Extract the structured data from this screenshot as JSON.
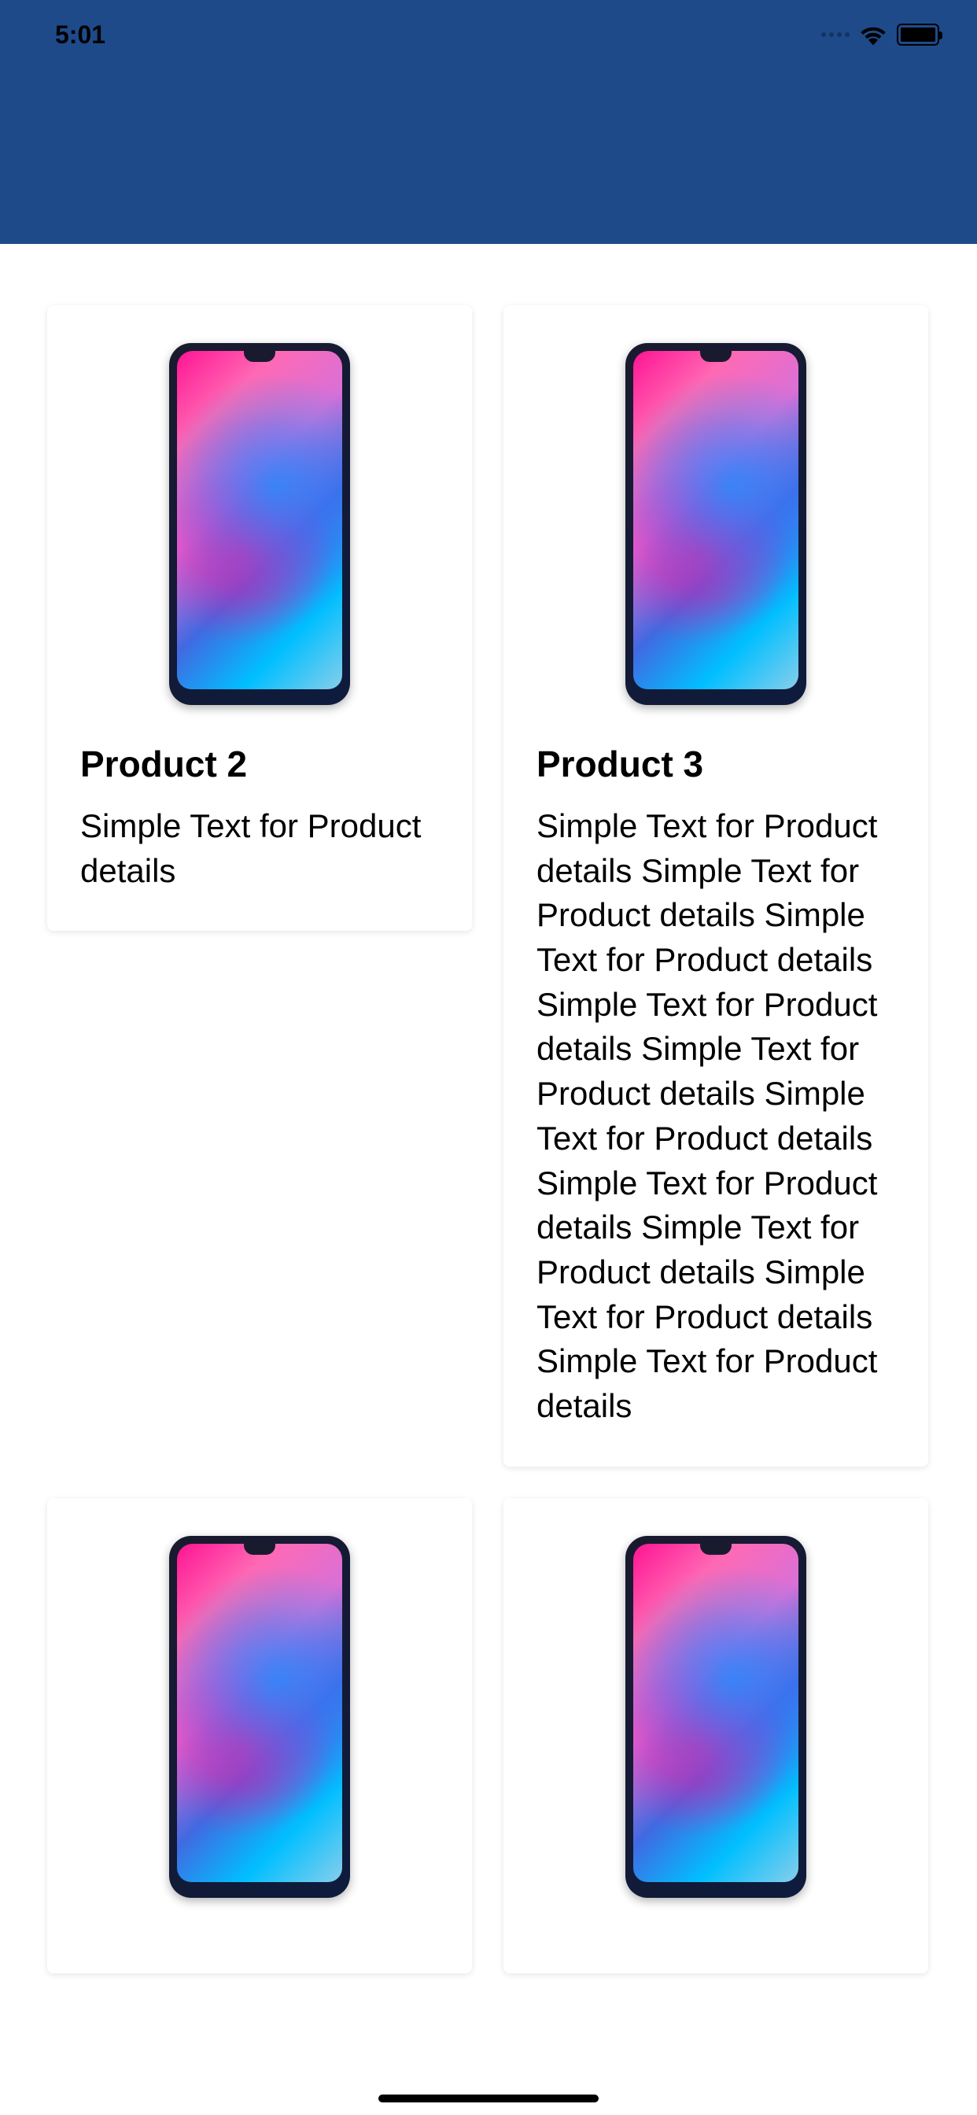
{
  "status": {
    "time": "5:01"
  },
  "products": [
    {
      "title": "Product  2",
      "description": "Simple Text for Product details"
    },
    {
      "title": "Product  3",
      "description": "Simple Text for Product details Simple Text for Product details Simple Text for Product details Simple Text for Product details Simple Text for Product details Simple Text for Product details Simple Text for Product details Simple Text for Product details Simple Text for Product details Simple Text for Product details"
    },
    {
      "title": "",
      "description": ""
    },
    {
      "title": "",
      "description": ""
    }
  ]
}
